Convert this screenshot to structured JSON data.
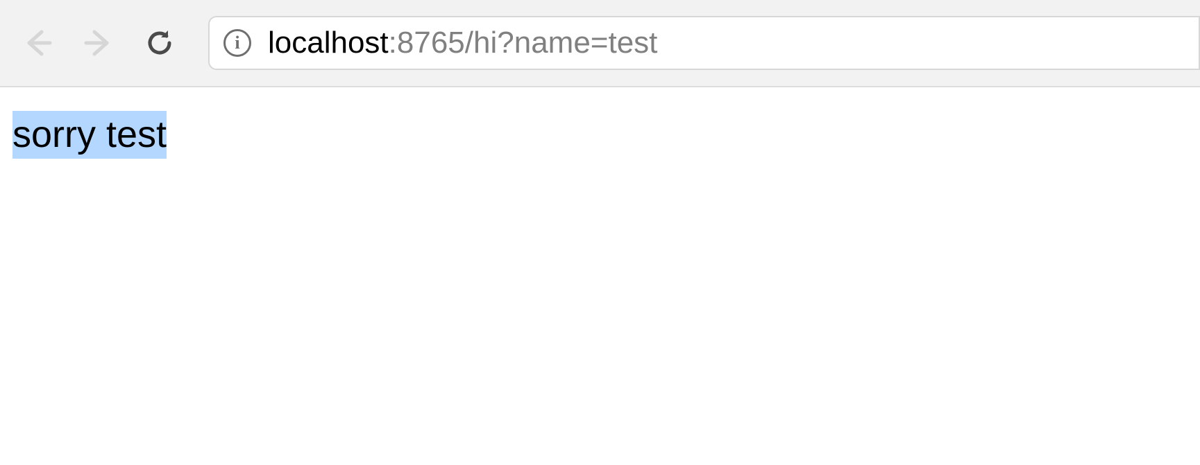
{
  "toolbar": {
    "url": {
      "host": "localhost",
      "rest": ":8765/hi?name=test"
    },
    "info_icon_glyph": "i"
  },
  "page": {
    "text": "sorry test"
  }
}
